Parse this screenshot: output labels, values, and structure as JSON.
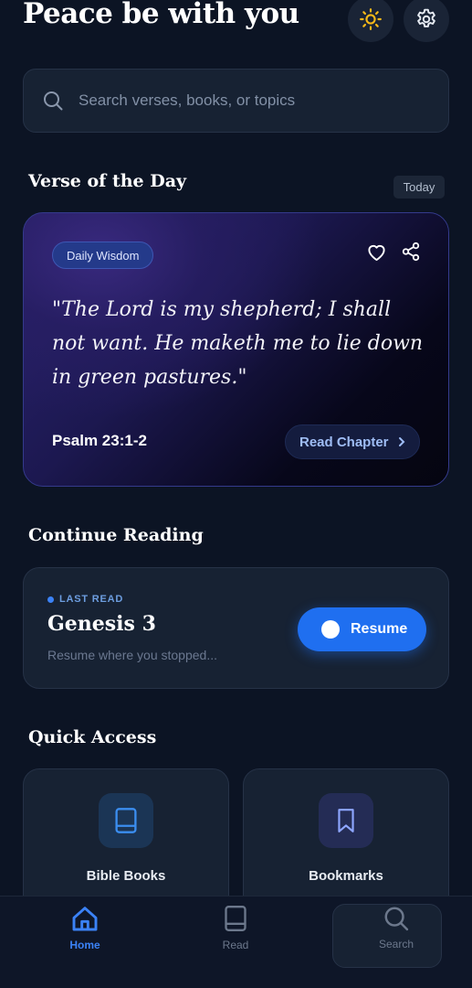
{
  "header": {
    "greeting": "Peace be with you",
    "theme_icon": "sun-icon",
    "settings_icon": "gear-icon"
  },
  "search": {
    "placeholder": "Search verses, books, or topics",
    "icon": "search-icon"
  },
  "verse_of_day": {
    "section_title": "Verse of the Day",
    "badge": "Today",
    "tag": "Daily Wisdom",
    "text": "\"The Lord is my shepherd; I shall not want. He maketh me to lie down in green pastures.\"",
    "reference": "Psalm 23:1-2",
    "action_label": "Read Chapter",
    "icons": [
      "heart-icon",
      "share-icon",
      "chevron-right-icon"
    ]
  },
  "continue_reading": {
    "section_title": "Continue Reading",
    "status": "LAST READ",
    "book": "Genesis 3",
    "subtitle": "Resume where you stopped...",
    "button_label": "Resume"
  },
  "quick_access": {
    "section_title": "Quick Access",
    "tiles": [
      {
        "label": "Bible Books",
        "icon": "book-icon"
      },
      {
        "label": "Bookmarks",
        "icon": "bookmark-icon"
      }
    ]
  },
  "bottom_nav": {
    "items": [
      {
        "label": "Home",
        "icon": "home-icon",
        "active": true
      },
      {
        "label": "Read",
        "icon": "book-icon",
        "active": false
      },
      {
        "label": "Search",
        "icon": "search-icon",
        "active": false
      }
    ]
  },
  "colors": {
    "background": "#0c1424",
    "surface": "#172233",
    "accent": "#1f6ff0",
    "active_nav": "#3b82f6",
    "sun": "#f5b818"
  }
}
